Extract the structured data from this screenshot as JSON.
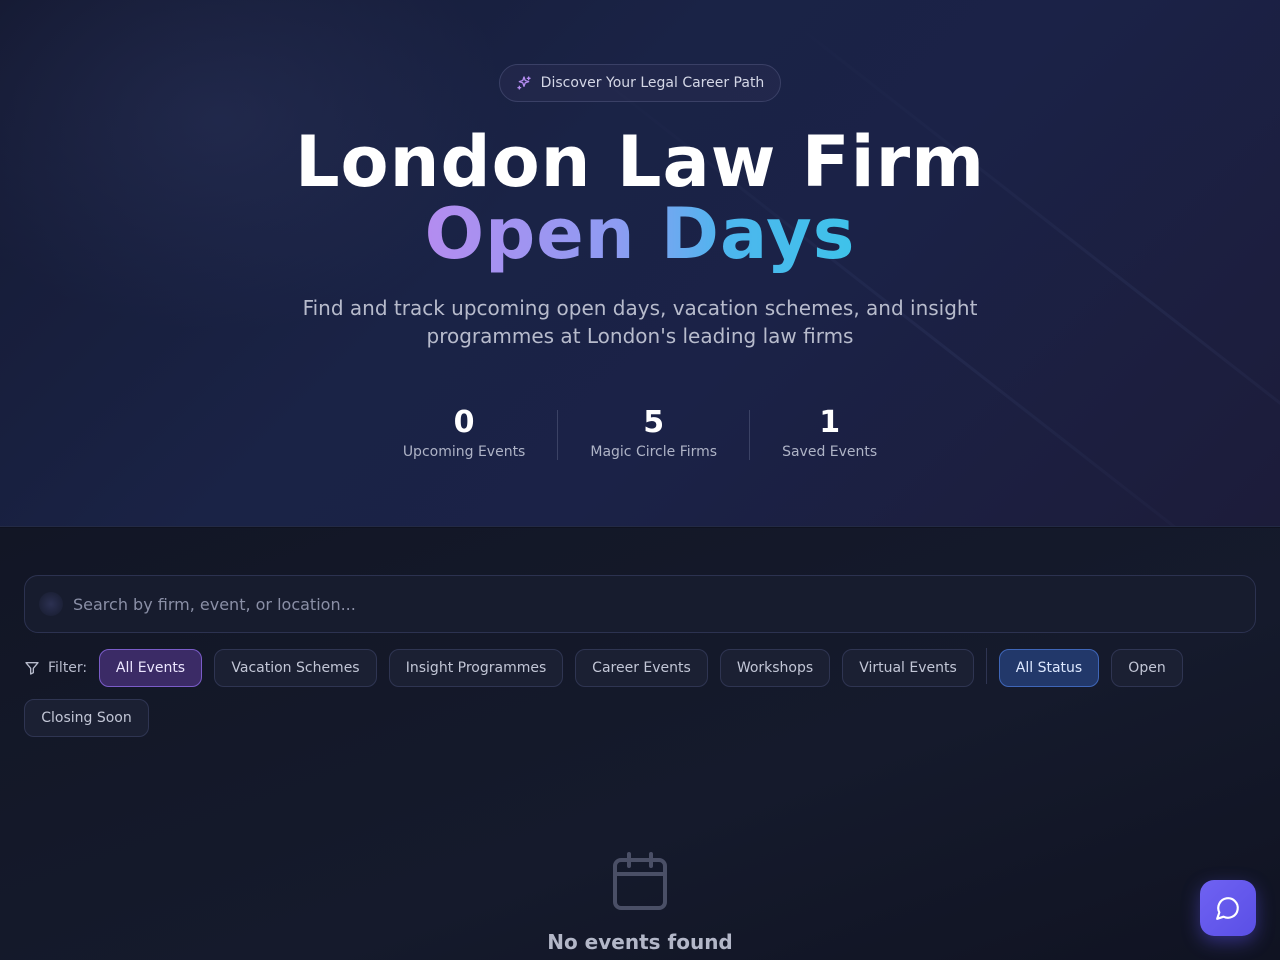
{
  "hero": {
    "badge_text": "Discover Your Legal Career Path",
    "title_line1": "London Law Firm",
    "title_line2": "Open Days",
    "subtitle": "Find and track upcoming open days, vacation schemes, and insight programmes at London's leading law firms",
    "stats": [
      {
        "value": "0",
        "label": "Upcoming Events"
      },
      {
        "value": "5",
        "label": "Magic Circle Firms"
      },
      {
        "value": "1",
        "label": "Saved Events"
      }
    ]
  },
  "search": {
    "placeholder": "Search by firm, event, or location...",
    "value": ""
  },
  "filters": {
    "label": "Filter:",
    "event_types": [
      "All Events",
      "Vacation Schemes",
      "Insight Programmes",
      "Career Events",
      "Workshops",
      "Virtual Events"
    ],
    "statuses": [
      "All Status",
      "Open",
      "Closing Soon"
    ],
    "selected_event_type": "All Events",
    "selected_status": "All Status"
  },
  "empty_state": {
    "title": "No events found"
  },
  "colors": {
    "accent_purple": "#7a5cc8",
    "accent_blue": "#3f66b8",
    "chat_button": "#6f62f2"
  },
  "icons": {
    "badge": "sparkles-icon",
    "filter": "filter-icon",
    "empty": "calendar-icon",
    "chat": "chat-bubble-icon"
  }
}
